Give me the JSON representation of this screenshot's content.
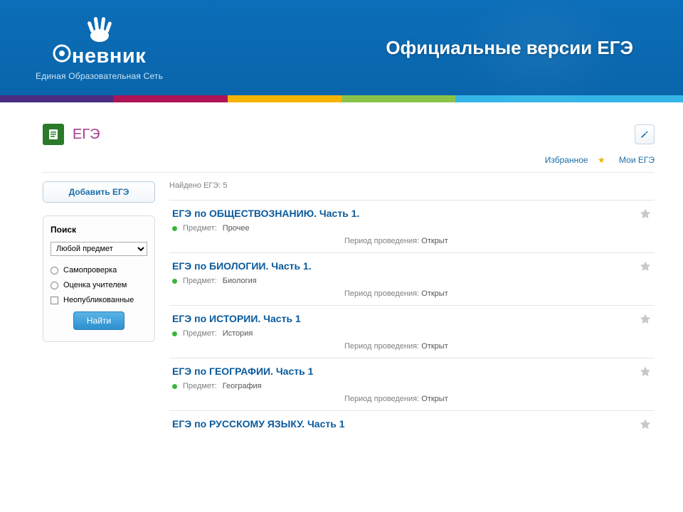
{
  "brand": {
    "title": "невник",
    "subtitle": "Единая Образовательная Сеть"
  },
  "header": {
    "title": "Официальные версии ЕГЭ"
  },
  "stripes": [
    "#4b2e83",
    "#ad1457",
    "#f5b400",
    "#8bc34a",
    "#35b6e6",
    "#35b6e6"
  ],
  "page": {
    "title": "ЕГЭ",
    "links": {
      "favorites": "Избранное",
      "my_ege": "Мои ЕГЭ"
    }
  },
  "sidebar": {
    "add_label": "Добавить ЕГЭ",
    "search_title": "Поиск",
    "subject_selected": "Любой предмет",
    "filters": {
      "selfcheck": "Самопроверка",
      "teacher": "Оценка учителем",
      "unpublished": "Неопубликованные"
    },
    "find_label": "Найти"
  },
  "results": {
    "found_prefix": "Найдено ЕГЭ:",
    "found_count": "5",
    "subject_label": "Предмет:",
    "period_label": "Период проведения:",
    "items": [
      {
        "title": "ЕГЭ по ОБЩЕСТВОЗНАНИЮ. Часть 1.",
        "subject": "Прочее",
        "period": "Открыт"
      },
      {
        "title": "ЕГЭ по БИОЛОГИИ. Часть 1.",
        "subject": "Биология",
        "period": "Открыт"
      },
      {
        "title": "ЕГЭ по ИСТОРИИ. Часть 1",
        "subject": "История",
        "period": "Открыт"
      },
      {
        "title": "ЕГЭ по ГЕОГРАФИИ. Часть 1",
        "subject": "География",
        "period": "Открыт"
      },
      {
        "title": "ЕГЭ по РУССКОМУ ЯЗЫКУ. Часть 1",
        "subject": "",
        "period": ""
      }
    ]
  }
}
